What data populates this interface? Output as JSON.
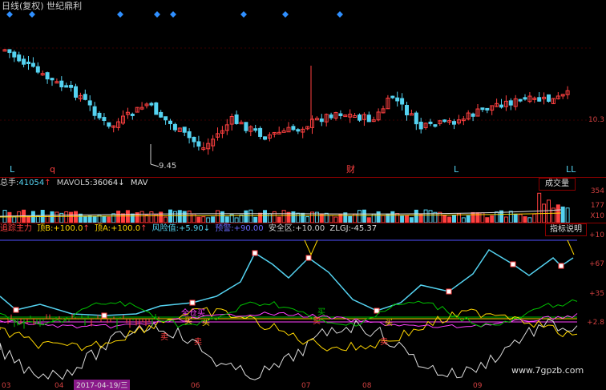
{
  "header": {
    "title": "日线(复权) 世纪鼎利"
  },
  "price_panel": {
    "low_marker": "9.45",
    "right_axis_label": "10.3",
    "markers": [
      "L",
      "q",
      "财",
      "L",
      "LL"
    ],
    "event_diamond_color": "#2f8fff",
    "up_color": "#ff4040",
    "down_color": "#54d2f0"
  },
  "volume_panel": {
    "label_total": "总手:",
    "total_value": "41054",
    "label_mavol5": "MAVOL5:",
    "mavol5_value": "36064",
    "label_mav": "MAV",
    "button": "成交量",
    "axis_labels": [
      "354",
      "177",
      "X10"
    ]
  },
  "indicator_panel": {
    "name": "追踪主力",
    "top_b_label": "顶B:",
    "top_b_value": "+100.0",
    "top_a_label": "顶A:",
    "top_a_value": "+100.0",
    "risk_label": "风险值:",
    "risk_value": "+5.90",
    "warn_label": "预警:",
    "warn_value": "+90.00",
    "safe_label": "安全区:",
    "safe_value": "+10.00",
    "zlgj_label": "ZLGJ:",
    "zlgj_value": "-45.37",
    "button": "指标说明",
    "axis_labels": [
      "+10",
      "+67",
      "+35",
      "+2.8"
    ],
    "annotations": [
      "卖",
      "卖",
      "卖",
      "卖",
      "买",
      "买",
      "买",
      "买",
      "全仓买"
    ]
  },
  "x_axis": {
    "labels": [
      "03",
      "04",
      "2017-04-19/三",
      "06",
      "07",
      "08",
      "09"
    ]
  },
  "watermark": "www.7gpzb.com"
}
